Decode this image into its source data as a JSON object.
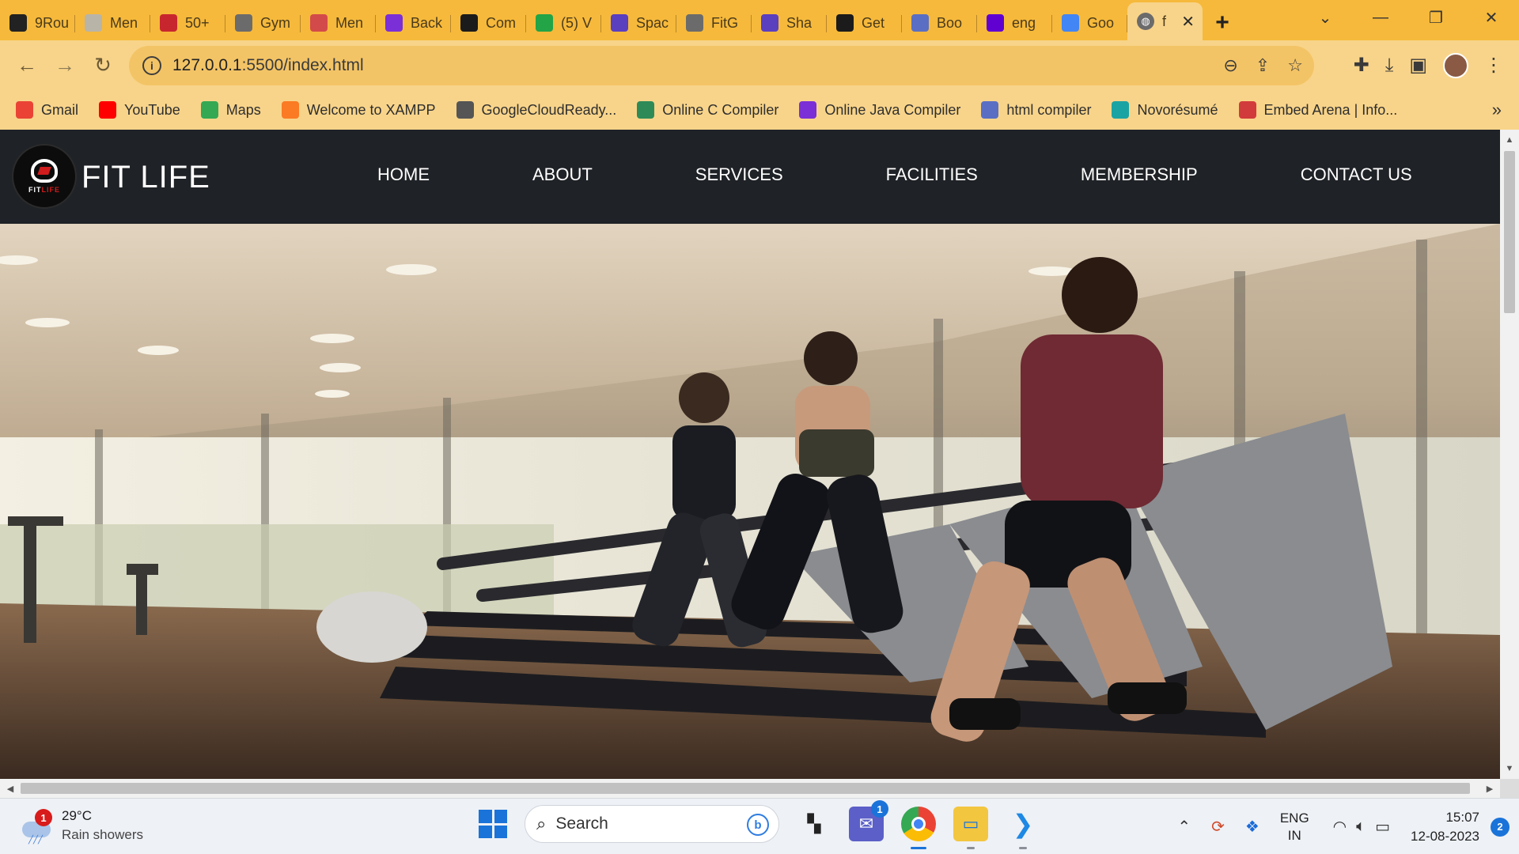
{
  "browser": {
    "tabs": [
      {
        "title": "9Rou",
        "icon": "tab-icon-9round",
        "color": "#222222"
      },
      {
        "title": "Men",
        "icon": "tab-icon-men",
        "color": "#b9b4a8"
      },
      {
        "title": "50+",
        "icon": "tab-icon-jr",
        "color": "#c8262e"
      },
      {
        "title": "Gym",
        "icon": "tab-icon-globe",
        "color": "#6b6b6b"
      },
      {
        "title": "Men",
        "icon": "tab-icon-heart",
        "color": "#d34a4a"
      },
      {
        "title": "Back",
        "icon": "tab-icon-b",
        "color": "#7b2fd6"
      },
      {
        "title": "Com",
        "icon": "tab-icon-github",
        "color": "#1b1b1b"
      },
      {
        "title": "(5) V",
        "icon": "tab-icon-whatsapp",
        "color": "#22a447"
      },
      {
        "title": "Spac",
        "icon": "tab-icon-b",
        "color": "#5a3fbf"
      },
      {
        "title": "FitG",
        "icon": "tab-icon-globe",
        "color": "#6b6b6b"
      },
      {
        "title": "Sha",
        "icon": "tab-icon-b",
        "color": "#5a3fbf"
      },
      {
        "title": "Get",
        "icon": "tab-icon-asterisk",
        "color": "#1b1b1b"
      },
      {
        "title": "Boo",
        "icon": "tab-icon-msb",
        "color": "#5a6fc4"
      },
      {
        "title": "eng",
        "icon": "tab-icon-yahoo",
        "color": "#6001d2"
      },
      {
        "title": "Goo",
        "icon": "tab-icon-translate",
        "color": "#4285f4"
      }
    ],
    "active_tab": {
      "title": "f",
      "close": "✕"
    },
    "new_tab": "+",
    "address": {
      "host": "127.0.0.1",
      "rest": ":5500/index.html"
    },
    "bookmarks": [
      {
        "label": "Gmail",
        "icon": "gmail-icon",
        "color": "#ea4335"
      },
      {
        "label": "YouTube",
        "icon": "youtube-icon",
        "color": "#ff0000"
      },
      {
        "label": "Maps",
        "icon": "maps-icon",
        "color": "#34a853"
      },
      {
        "label": "Welcome to XAMPP",
        "icon": "xampp-icon",
        "color": "#fb7a24"
      },
      {
        "label": "GoogleCloudReady...",
        "icon": "globe-icon",
        "color": "#555555"
      },
      {
        "label": "Online C Compiler",
        "icon": "code-icon",
        "color": "#2e8b57"
      },
      {
        "label": "Online Java Compiler",
        "icon": "java-icon",
        "color": "#7b2fd6"
      },
      {
        "label": "html compiler",
        "icon": "code-icon",
        "color": "#5a6fc4"
      },
      {
        "label": "Novorésumé",
        "icon": "novoresume-icon",
        "color": "#1aa3a3"
      },
      {
        "label": "Embed Arena | Info...",
        "icon": "embed-icon",
        "color": "#d23b3b"
      }
    ]
  },
  "site": {
    "brand": "FIT LIFE",
    "logo_text_a": "FIT",
    "logo_text_b": "LIFE",
    "nav": [
      "HOME",
      "ABOUT",
      "SERVICES",
      "FACILITIES",
      "MEMBERSHIP",
      "CONTACT US"
    ],
    "hero_image": "treadmill-runners-photo"
  },
  "taskbar": {
    "weather": {
      "temp": "29°C",
      "desc": "Rain showers",
      "badge": "1"
    },
    "search_placeholder": "Search",
    "teams_badge": "1",
    "language": {
      "line1": "ENG",
      "line2": "IN"
    },
    "time": "15:07",
    "date": "12-08-2023",
    "notifications": "2"
  }
}
